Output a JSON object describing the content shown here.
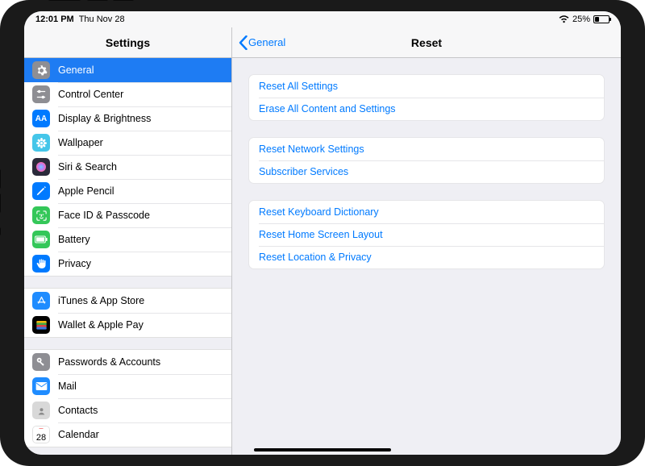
{
  "status": {
    "time": "12:01 PM",
    "date": "Thu Nov 28",
    "battery_pct": "25%"
  },
  "sidebar": {
    "title": "Settings",
    "groups": [
      {
        "items": [
          {
            "id": "general",
            "label": "General",
            "icon": "gear",
            "bg": "#8e8e93",
            "selected": true
          },
          {
            "id": "control-center",
            "label": "Control Center",
            "icon": "sliders",
            "bg": "#8e8e93"
          },
          {
            "id": "display",
            "label": "Display & Brightness",
            "icon": "AA",
            "bg": "#007aff"
          },
          {
            "id": "wallpaper",
            "label": "Wallpaper",
            "icon": "flower",
            "bg": "#45c6e9"
          },
          {
            "id": "siri",
            "label": "Siri & Search",
            "icon": "siri",
            "bg": "#2a2a3a"
          },
          {
            "id": "apple-pencil",
            "label": "Apple Pencil",
            "icon": "pencil",
            "bg": "#007aff"
          },
          {
            "id": "faceid",
            "label": "Face ID & Passcode",
            "icon": "face",
            "bg": "#34c759"
          },
          {
            "id": "battery",
            "label": "Battery",
            "icon": "battery",
            "bg": "#34c759"
          },
          {
            "id": "privacy",
            "label": "Privacy",
            "icon": "hand",
            "bg": "#007aff"
          }
        ]
      },
      {
        "items": [
          {
            "id": "itunes",
            "label": "iTunes & App Store",
            "icon": "appstore",
            "bg": "#1f8cff"
          },
          {
            "id": "wallet",
            "label": "Wallet & Apple Pay",
            "icon": "wallet",
            "bg": "#000000"
          }
        ]
      },
      {
        "items": [
          {
            "id": "passwords",
            "label": "Passwords & Accounts",
            "icon": "key",
            "bg": "#8e8e93"
          },
          {
            "id": "mail",
            "label": "Mail",
            "icon": "mail",
            "bg": "#1f8cff"
          },
          {
            "id": "contacts",
            "label": "Contacts",
            "icon": "contacts",
            "bg": "#bdbdbd"
          },
          {
            "id": "calendar",
            "label": "Calendar",
            "icon": "calendar",
            "bg": "#ffffff"
          }
        ]
      }
    ]
  },
  "detail": {
    "back_label": "General",
    "title": "Reset",
    "groups": [
      [
        "Reset All Settings",
        "Erase All Content and Settings"
      ],
      [
        "Reset Network Settings",
        "Subscriber Services"
      ],
      [
        "Reset Keyboard Dictionary",
        "Reset Home Screen Layout",
        "Reset Location & Privacy"
      ]
    ]
  }
}
